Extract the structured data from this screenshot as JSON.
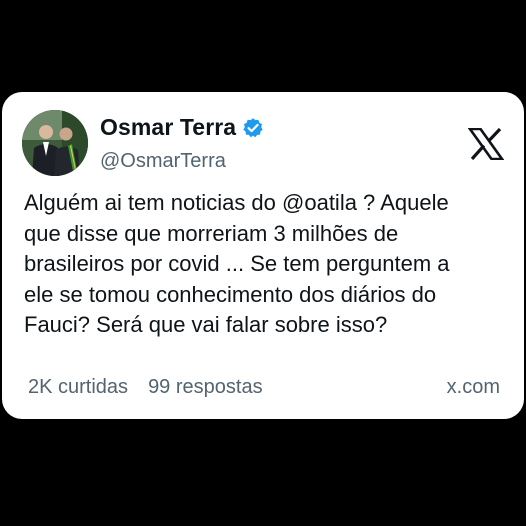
{
  "tweet": {
    "author": {
      "display_name": "Osmar Terra",
      "handle": "@OsmarTerra",
      "verified": true
    },
    "text": "Alguém ai tem noticias do @oatila ? Aquele\nque disse que morreriam 3 milhões de\nbrasileiros por covid ... Se tem perguntem a\nele se tomou conhecimento dos diários do\nFauci? Será que vai falar sobre isso?",
    "stats": {
      "likes": "2K curtidas",
      "replies": "99 respostas"
    },
    "source": "x.com"
  },
  "icons": {
    "platform": "x-logo-icon",
    "badge": "verified-badge-icon"
  },
  "colors": {
    "background": "#000000",
    "card": "#ffffff",
    "text": "#0f1419",
    "muted": "#536471",
    "verified": "#1d9bf0"
  }
}
